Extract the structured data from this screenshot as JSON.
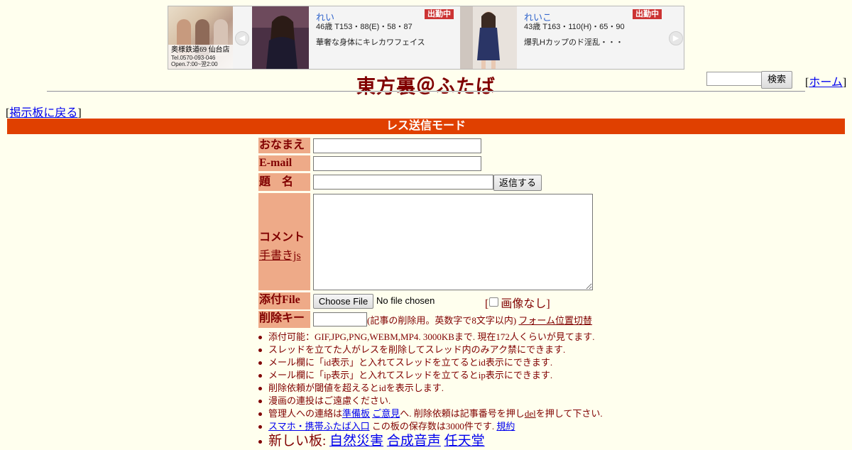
{
  "banner": {
    "shop": {
      "name": "奥様鉄道69 仙台店",
      "tel": "Tel.0570-093-046",
      "hours": "Open.7:00~翌2:00"
    },
    "cards": [
      {
        "name": "れい",
        "badge": "出勤中",
        "stats": "46歳 T153・88(E)・58・87",
        "desc": "華奢な身体にキレカワフェイス"
      },
      {
        "name": "れいこ",
        "badge": "出勤中",
        "stats": "43歳 T163・110(H)・65・90",
        "desc": "爆乳Hカップのド淫乱・・・"
      }
    ]
  },
  "header": {
    "title": "東方裏＠ふたば",
    "search_button": "検索",
    "home_open": "[",
    "home_label": "ホーム",
    "home_close": "]"
  },
  "nav": {
    "back_open": "[",
    "back_label": "掲示板に戻る",
    "back_close": "]"
  },
  "mode_bar": "レス送信モード",
  "form": {
    "name_label": "おなまえ",
    "email_label": "E-mail",
    "subject_label": "題　名",
    "submit_button": "返信する",
    "comment_label": "コメント",
    "handwriting_link": "手書きjs",
    "file_label": "添付File",
    "file_button": "Choose File",
    "file_status": "No file chosen",
    "no_image_open": "[",
    "no_image_label": "画像なし]",
    "delkey_label": "削除キー",
    "delkey_note": "(記事の削除用。英数字で8文字以内)",
    "form_position_link": "フォーム位置切替"
  },
  "notes": {
    "n1": "添付可能：GIF,JPG,PNG,WEBM,MP4. 3000KBまで. 現在172人くらいが見てます.",
    "n2": "スレッドを立てた人がレスを削除してスレッド内のみアク禁にできます.",
    "n3": "メール欄に「id表示」と入れてスレッドを立てるとid表示にできます.",
    "n4": "メール欄に「ip表示」と入れてスレッドを立てるとip表示にできます.",
    "n5": "削除依頼が閾値を超えるとidを表示します.",
    "n6": "漫画の連投はご遠慮ください.",
    "n7_a": "管理人への連絡は",
    "n7_link1": "準備板",
    "n7_link2": "ご意見",
    "n7_b": "へ. 削除依頼は記事番号を押し",
    "n7_link3": "del",
    "n7_c": "を押して下さい.",
    "n8_link1": "スマホ・携帯ふたば入口",
    "n8_b": " この板の保存数は3000件です.",
    "n8_link2": "規約",
    "n9_label": "新しい板:",
    "n9_links": [
      "自然災害",
      "合成音声",
      "任天堂"
    ]
  },
  "colors": {
    "background": "#ffffee",
    "text": "#800000",
    "mode_bar": "#e04000",
    "form_label_bg": "#eeaa88",
    "link": "#0000ee",
    "badge": "#cc3333"
  }
}
